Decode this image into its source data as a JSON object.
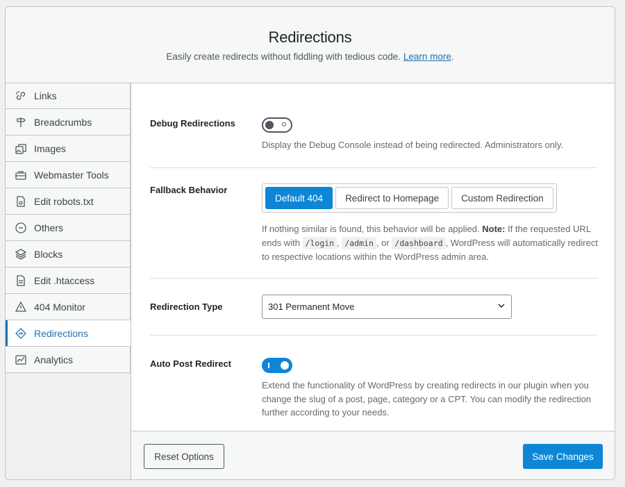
{
  "header": {
    "title": "Redirections",
    "subtitle": "Easily create redirects without fiddling with tedious code.",
    "learn_more": "Learn more",
    "period": "."
  },
  "sidebar": {
    "items": [
      {
        "label": "Links",
        "icon": "links-icon"
      },
      {
        "label": "Breadcrumbs",
        "icon": "signpost-icon"
      },
      {
        "label": "Images",
        "icon": "images-icon"
      },
      {
        "label": "Webmaster Tools",
        "icon": "toolbox-icon"
      },
      {
        "label": "Edit robots.txt",
        "icon": "robots-file-icon"
      },
      {
        "label": "Others",
        "icon": "circle-dots-icon"
      },
      {
        "label": "Blocks",
        "icon": "blocks-icon"
      },
      {
        "label": "Edit .htaccess",
        "icon": "htaccess-file-icon"
      },
      {
        "label": "404 Monitor",
        "icon": "warning-icon"
      },
      {
        "label": "Redirections",
        "icon": "redirect-icon",
        "active": true
      },
      {
        "label": "Analytics",
        "icon": "analytics-icon"
      }
    ]
  },
  "settings": {
    "debug": {
      "label": "Debug Redirections",
      "enabled": false,
      "description": "Display the Debug Console instead of being redirected. Administrators only."
    },
    "fallback": {
      "label": "Fallback Behavior",
      "options": [
        "Default 404",
        "Redirect to Homepage",
        "Custom Redirection"
      ],
      "selected": "Default 404",
      "desc_intro": "If nothing similar is found, this behavior will be applied.",
      "note_label": "Note:",
      "desc_part1": "If the requested URL ends with",
      "code1": "/login",
      "sep1": ",",
      "code2": "/admin",
      "sep2": ", or",
      "code3": "/dashboard",
      "desc_part2": ", WordPress will automatically redirect to respective locations within the WordPress admin area."
    },
    "redirection_type": {
      "label": "Redirection Type",
      "value": "301 Permanent Move"
    },
    "auto_post": {
      "label": "Auto Post Redirect",
      "enabled": true,
      "description": "Extend the functionality of WordPress by creating redirects in our plugin when you change the slug of a post, page, category or a CPT. You can modify the redirection further according to your needs."
    }
  },
  "footer": {
    "reset_label": "Reset Options",
    "save_label": "Save Changes"
  },
  "colors": {
    "accent": "#0d86d6",
    "link": "#2271b1"
  }
}
